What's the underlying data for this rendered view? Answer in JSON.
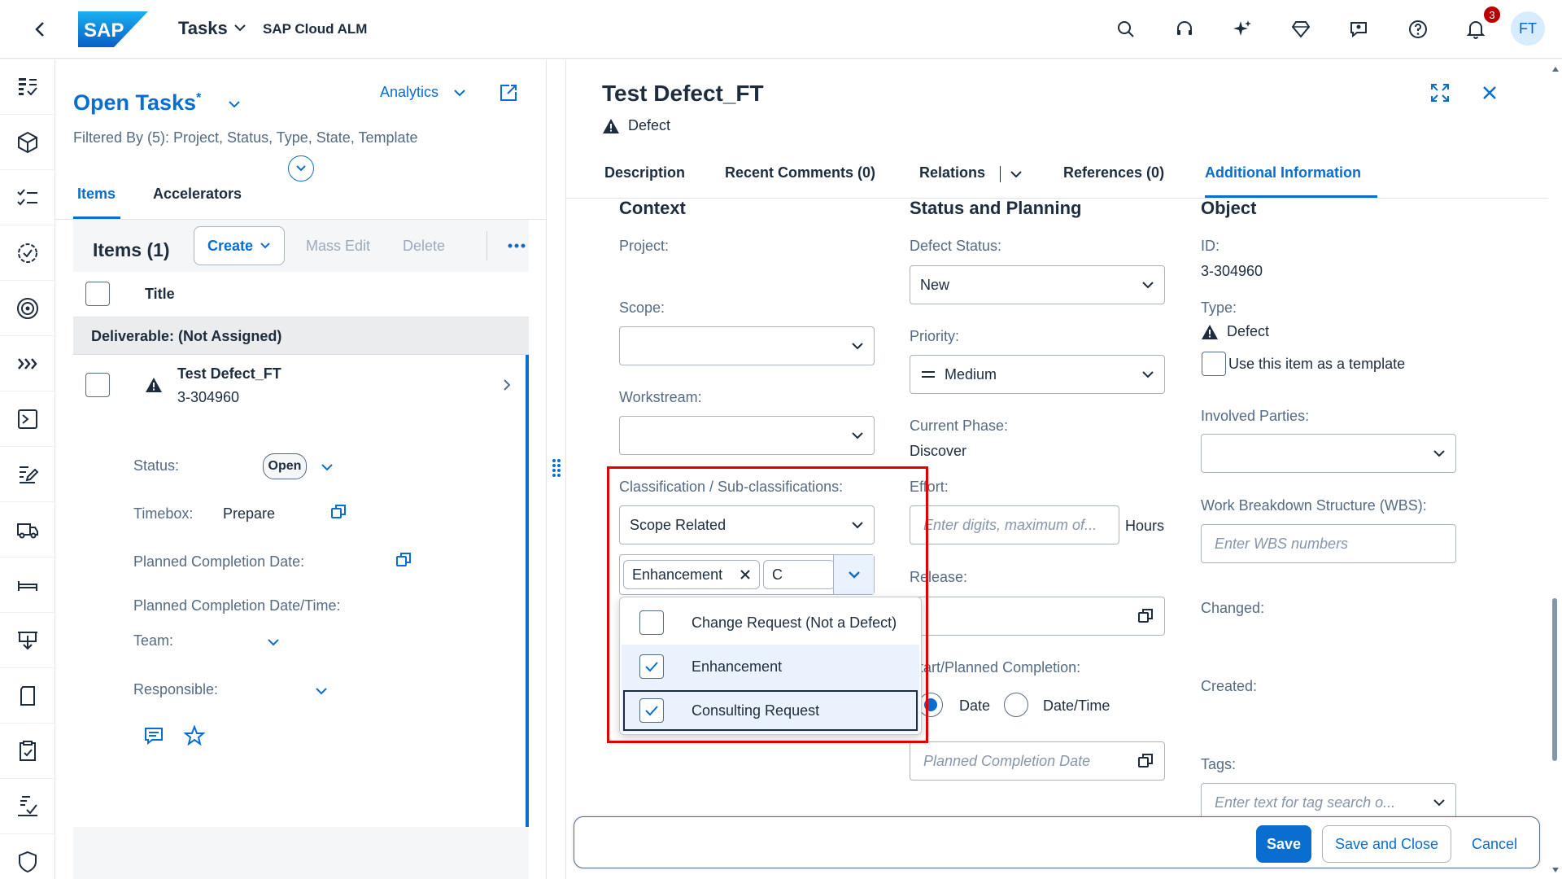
{
  "shell": {
    "title": "Tasks",
    "subtitle": "SAP Cloud ALM",
    "logo_text": "SAP",
    "notification_count": "3",
    "avatar_initials": "FT"
  },
  "rail": {
    "icons": [
      "overview-icon",
      "box-icon",
      "checklist-icon",
      "badge-check-icon",
      "target-icon",
      "chevrons-right-icon",
      "process-icon",
      "edit-icon",
      "truck-icon",
      "bed-icon",
      "download-board-icon",
      "document-icon",
      "clipboard-check-icon",
      "approval-icon",
      "shield-check-icon"
    ]
  },
  "list": {
    "title": "Open Tasks",
    "asterisk": "*",
    "filter_text": "Filtered By (5): Project, Status, Type, State, Template",
    "analytics_label": "Analytics",
    "tabs": [
      "Items",
      "Accelerators"
    ],
    "items_title": "Items (1)",
    "create_label": "Create",
    "mass_edit_label": "Mass Edit",
    "delete_label": "Delete",
    "column_title": "Title",
    "group_label": "Deliverable: (Not Assigned)",
    "item": {
      "title": "Test Defect_FT",
      "id": "3-304960",
      "status_label": "Status:",
      "status_value": "Open",
      "timebox_label": "Timebox:",
      "timebox_value": "Prepare",
      "planned_date_label": "Planned Completion Date:",
      "planned_datetime_label": "Planned Completion Date/Time:",
      "team_label": "Team:",
      "responsible_label": "Responsible:"
    }
  },
  "detail": {
    "title": "Test Defect_FT",
    "type": "Defect",
    "tabs": [
      "Description",
      "Recent Comments (0)",
      "Relations",
      "References (0)",
      "Additional Information"
    ],
    "active_tab": "Additional Information",
    "context": {
      "heading": "Context",
      "project_label": "Project:",
      "scope_label": "Scope:",
      "workstream_label": "Workstream:",
      "classification_label": "Classification / Sub-classifications:",
      "classification_value": "Scope Related",
      "token": "Enhancement",
      "sub_input_value": "C",
      "options": [
        {
          "label": "Change Request (Not a Defect)",
          "checked": false
        },
        {
          "label": "Enhancement",
          "checked": true
        },
        {
          "label": "Consulting Request",
          "checked": true
        }
      ]
    },
    "status": {
      "heading": "Status and Planning",
      "defect_status_label": "Defect Status:",
      "defect_status_value": "New",
      "priority_label": "Priority:",
      "priority_value": "Medium",
      "phase_label": "Current Phase:",
      "phase_value": "Discover",
      "effort_label": "Effort:",
      "effort_placeholder": "Enter digits, maximum of...",
      "effort_unit": "Hours",
      "release_label": "Release:",
      "start_label": "Start/Planned Completion:",
      "radio_date": "Date",
      "radio_datetime": "Date/Time",
      "planned_placeholder": "Planned Completion Date"
    },
    "object": {
      "heading": "Object",
      "id_label": "ID:",
      "id_value": "3-304960",
      "type_label": "Type:",
      "type_value": "Defect",
      "template_label": "Use this item as a template",
      "parties_label": "Involved Parties:",
      "wbs_label": "Work Breakdown Structure (WBS):",
      "wbs_placeholder": "Enter WBS numbers",
      "changed_label": "Changed:",
      "created_label": "Created:",
      "tags_label": "Tags:",
      "tags_placeholder": "Enter text for tag search o..."
    },
    "footer": {
      "save": "Save",
      "save_close": "Save and Close",
      "cancel": "Cancel"
    }
  },
  "colors": {
    "brand": "#0a6ed1",
    "highlight": "#e00000",
    "badge": "#bb0000"
  }
}
